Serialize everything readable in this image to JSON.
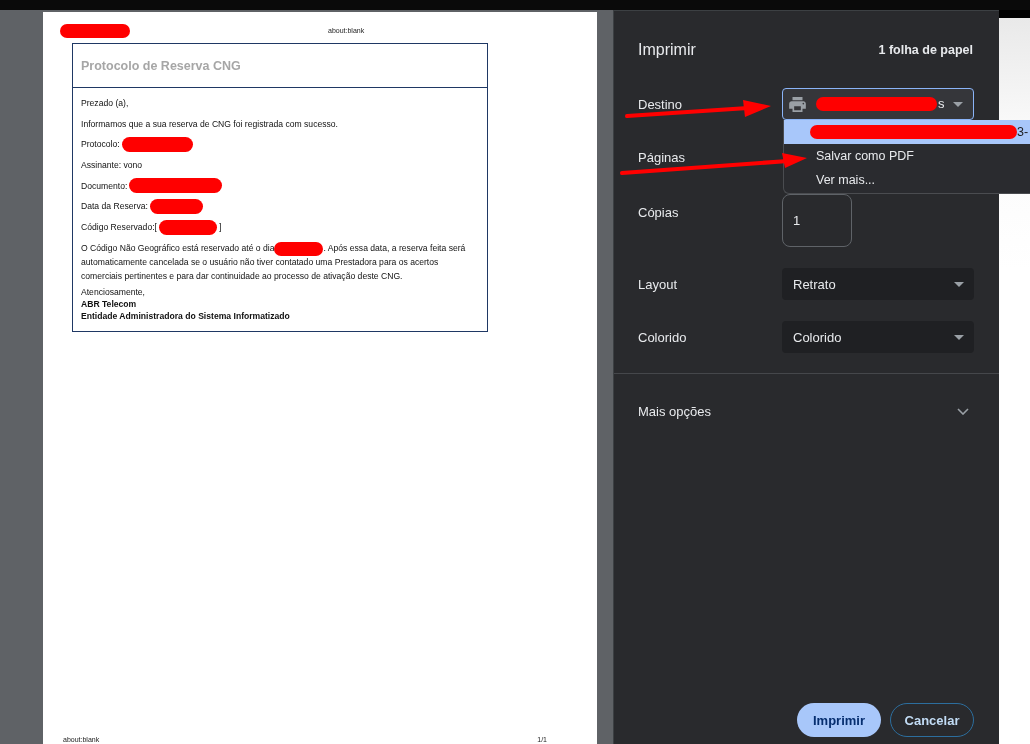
{
  "preview": {
    "header": {
      "left_redacted": true,
      "title": "about:blank"
    },
    "document": {
      "title": "Protocolo de Reserva CNG",
      "lines": [
        {
          "kind": "text",
          "text": "Prezado (a),"
        },
        {
          "kind": "text",
          "text": "Informamos que a sua reserva de CNG foi registrada com sucesso."
        },
        {
          "kind": "field",
          "label": "Protocolo:",
          "redacted": true
        },
        {
          "kind": "text",
          "text": "Assinante: vono"
        },
        {
          "kind": "field",
          "label": "Documento:",
          "redacted": true
        },
        {
          "kind": "field",
          "label": "Data da Reserva:",
          "redacted": true
        },
        {
          "kind": "field",
          "label": "Código Reservado:[",
          "redacted": true,
          "suffix": "]"
        },
        {
          "kind": "paragraph",
          "before": "O Código Não Geográfico está reservado até o dia",
          "redacted": true,
          "after": ". Após essa data, a reserva feita será automaticamente cancelada se o usuário não tiver contatado uma Prestadora para os acertos comerciais pertinentes e para dar continuidade ao processo de ativação deste CNG."
        }
      ],
      "closing": "Atenciosamente,",
      "signature": [
        "ABR Telecom",
        "Entidade Administradora do Sistema Informatizado"
      ]
    },
    "footer": {
      "left": "about:blank",
      "right": "1/1"
    }
  },
  "print_panel": {
    "title": "Imprimir",
    "sheet_count": "1 folha de papel",
    "settings": [
      {
        "kind": "destination",
        "label": "Destino",
        "redacted": true,
        "visible_value": "s",
        "focused": true
      },
      {
        "kind": "pages",
        "label": "Páginas"
      },
      {
        "kind": "copies",
        "label": "Cópias",
        "value": "1"
      },
      {
        "kind": "select",
        "label": "Layout",
        "value": "Retrato"
      },
      {
        "kind": "select",
        "label": "Colorido",
        "value": "Colorido"
      }
    ],
    "destination_menu": [
      {
        "label": "3-",
        "redacted": true,
        "selected": true
      },
      {
        "label": "Salvar como PDF",
        "redacted": false,
        "selected": false
      },
      {
        "label": "Ver mais...",
        "redacted": false,
        "selected": false
      }
    ],
    "more_options": {
      "label": "Mais opções",
      "expanded": false
    },
    "buttons": [
      {
        "kind": "primary",
        "label": "Imprimir"
      },
      {
        "kind": "secondary",
        "label": "Cancelar"
      }
    ]
  }
}
